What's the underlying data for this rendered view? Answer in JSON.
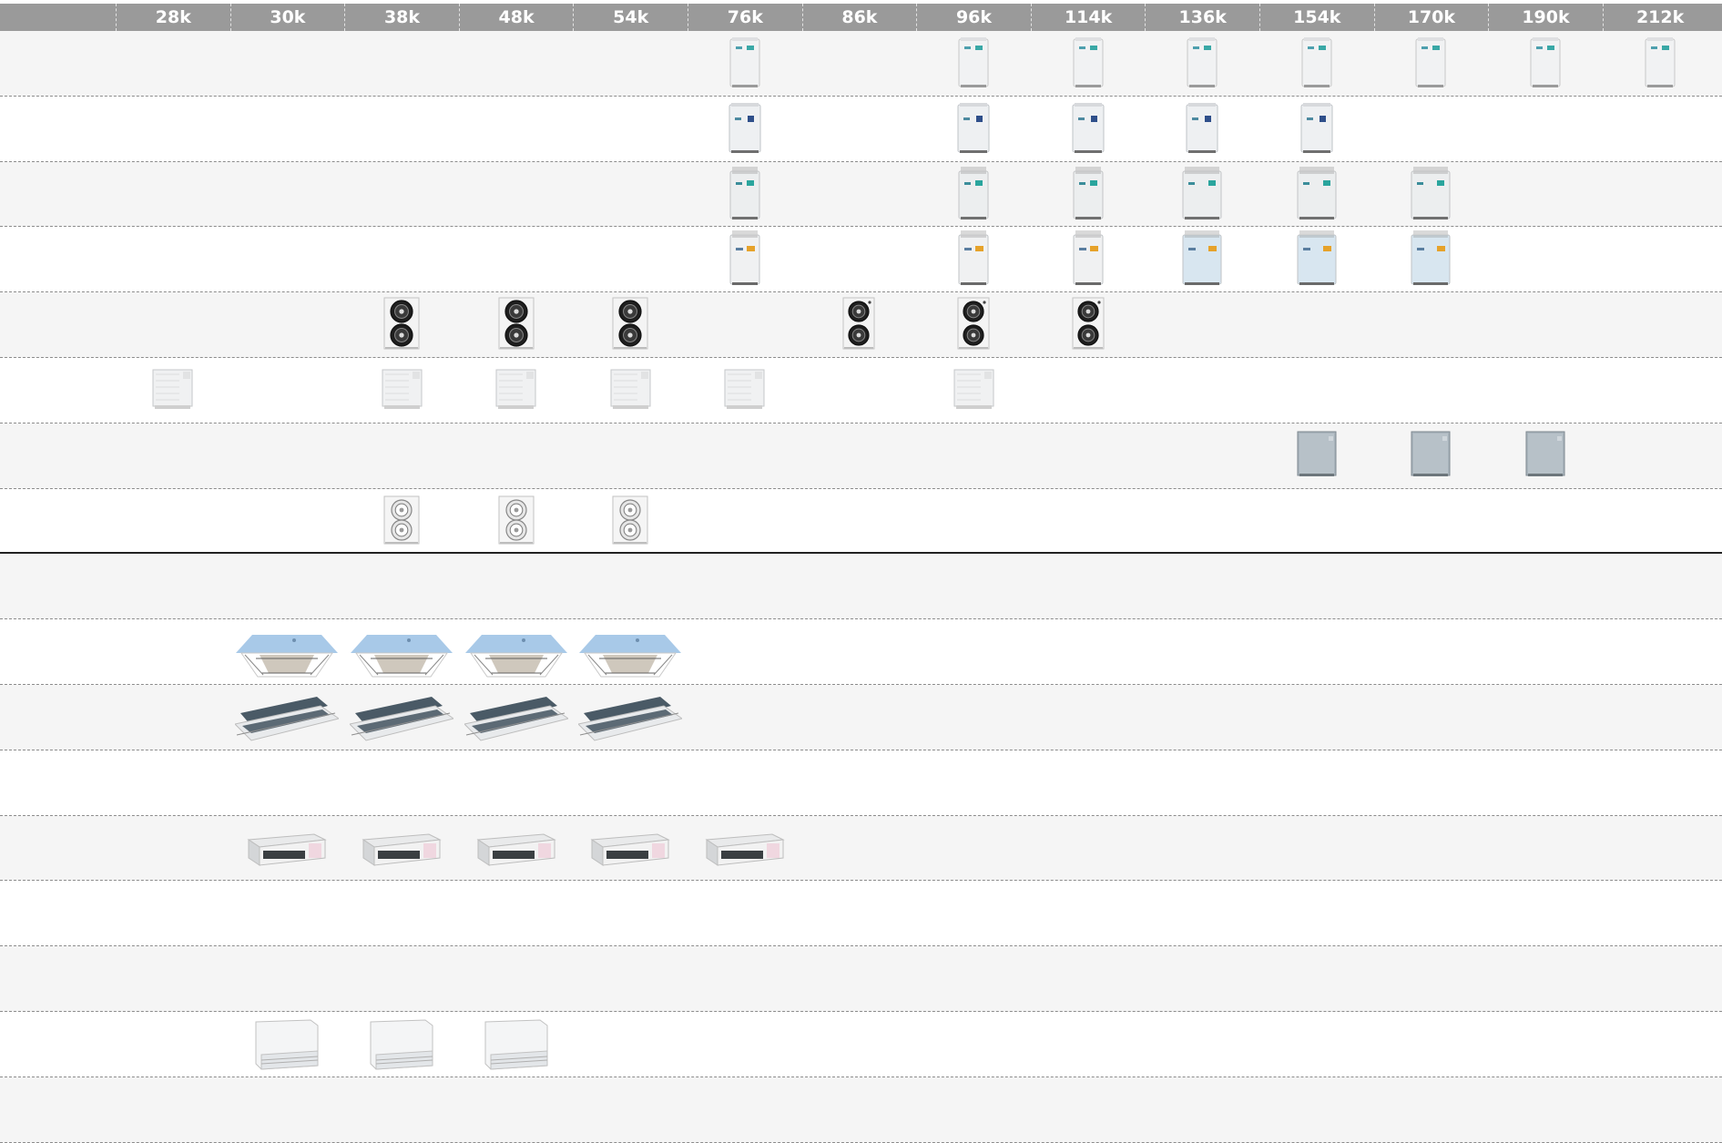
{
  "columns": [
    "28k",
    "30k",
    "38k",
    "48k",
    "54k",
    "76k",
    "86k",
    "96k",
    "114k",
    "136k",
    "154k",
    "170k",
    "190k",
    "212k"
  ],
  "rows": [
    {
      "type": "vrf-white-single",
      "columns": [
        "76k",
        "96k",
        "114k",
        "136k",
        "154k",
        "170k",
        "190k",
        "212k"
      ]
    },
    {
      "type": "vrf-white-blue-badge",
      "columns": [
        "76k",
        "96k",
        "114k",
        "136k",
        "154k"
      ]
    },
    {
      "type": "vrf-grille-top",
      "columns": [
        "76k",
        "96k",
        "114k",
        "136k",
        "154k",
        "170k"
      ]
    },
    {
      "type": "vrf-orange-badge",
      "columns": [
        "76k",
        "96k",
        "114k",
        "136k",
        "154k",
        "170k"
      ]
    },
    {
      "type": "outdoor-dual-fan-dark",
      "columns": [
        "38k",
        "48k",
        "54k",
        "86k",
        "96k",
        "114k"
      ]
    },
    {
      "type": "outdoor-box-light",
      "columns": [
        "28k",
        "38k",
        "48k",
        "54k",
        "76k",
        "96k"
      ]
    },
    {
      "type": "outdoor-box-dark",
      "columns": [
        "154k",
        "170k",
        "190k"
      ]
    },
    {
      "type": "outdoor-dual-fan-light",
      "columns": [
        "38k",
        "48k",
        "54k"
      ]
    },
    {
      "type": "empty",
      "columns": []
    },
    {
      "type": "cassette-4way",
      "columns": [
        "30k",
        "38k",
        "48k",
        "54k"
      ]
    },
    {
      "type": "cassette-1way",
      "columns": [
        "30k",
        "38k",
        "48k",
        "54k"
      ]
    },
    {
      "type": "empty",
      "columns": []
    },
    {
      "type": "ducted-unit",
      "columns": [
        "30k",
        "38k",
        "48k",
        "54k",
        "76k"
      ]
    },
    {
      "type": "empty",
      "columns": []
    },
    {
      "type": "empty",
      "columns": []
    },
    {
      "type": "floor-ceiling",
      "columns": [
        "30k",
        "38k",
        "48k"
      ]
    },
    {
      "type": "empty",
      "columns": []
    }
  ]
}
